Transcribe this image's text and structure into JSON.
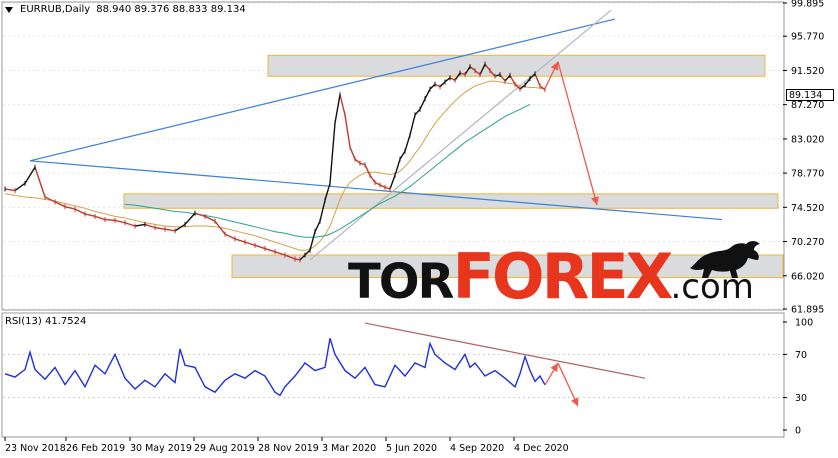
{
  "header": {
    "symbol": "EURRUB,Daily",
    "ohlc": "88.940 89.376 88.833 89.134",
    "arrow_icon": "triangle-down-icon"
  },
  "logo": {
    "part1": "TOR",
    "part2": "FOREX",
    "part3": ".com",
    "colors": {
      "tor": "#111111",
      "forex": "#e8351e",
      "com": "#111111"
    },
    "mascot": "bull-icon"
  },
  "colors": {
    "price_up": "#111111",
    "price_down": "#c0392b",
    "ma_fast": "#d4a04a",
    "ma_slow": "#2aa38a",
    "trend_line": "#3a7fd9",
    "channel_line": "#b0b6c0",
    "zone_fill": "#d9dadc",
    "zone_border": "#f2b233",
    "arrow": "#ee5a4a",
    "rsi_line": "#1f2fe0",
    "rsi_trend": "#b06060",
    "last_price_bg": "#ffffff"
  },
  "chart_data": [
    {
      "type": "line",
      "name": "price",
      "ylim": [
        61.895,
        99.895
      ],
      "y_ticks": [
        "99.895",
        "95.770",
        "91.520",
        "87.270",
        "83.020",
        "78.770",
        "74.520",
        "70.270",
        "66.020",
        "61.895"
      ],
      "last_price": "89.134",
      "x_ticks": [
        "23 Nov 2018",
        "26 Feb 2019",
        "30 May 2019",
        "29 Aug 2019",
        "28 Nov 2019",
        "3 Mar 2020",
        "5 Jun 2020",
        "4 Sep 2020",
        "4 Dec 2020"
      ],
      "x": [
        0,
        10,
        20,
        30,
        40,
        50,
        60,
        70,
        80,
        90,
        100,
        110,
        120,
        130,
        140,
        150,
        160,
        170,
        180,
        190,
        200,
        210,
        220,
        230,
        240,
        250,
        260,
        270,
        280,
        290,
        295,
        300,
        305,
        310,
        315,
        320,
        325,
        330,
        335,
        340,
        345,
        350,
        355,
        360,
        365,
        370,
        375,
        380,
        385,
        390,
        395,
        400,
        405,
        410,
        415,
        420,
        425,
        430,
        435,
        440,
        445,
        450,
        455,
        460,
        465,
        470,
        475,
        480,
        485,
        490,
        495,
        500,
        505,
        510,
        515,
        520,
        525,
        530,
        535,
        540
      ],
      "close": [
        76.8,
        76.6,
        77.5,
        79.5,
        75.8,
        75.2,
        74.6,
        74.3,
        73.7,
        73.4,
        73.0,
        72.9,
        72.6,
        72.2,
        72.4,
        72.0,
        71.8,
        71.6,
        72.4,
        73.8,
        73.4,
        72.8,
        71.2,
        70.6,
        70.2,
        69.8,
        69.4,
        69.0,
        68.6,
        68.1,
        68.0,
        68.6,
        69.2,
        71.5,
        72.8,
        75.4,
        77.5,
        85.0,
        88.5,
        86.0,
        82.0,
        80.5,
        80.0,
        79.8,
        78.5,
        77.6,
        77.3,
        77.0,
        76.8,
        78.5,
        80.5,
        81.5,
        83.5,
        86.0,
        86.7,
        88.0,
        89.2,
        89.8,
        89.5,
        90.1,
        90.6,
        90.3,
        91.2,
        91.0,
        92.0,
        91.5,
        91.0,
        92.3,
        91.5,
        90.8,
        91.0,
        90.2,
        90.9,
        89.8,
        89.2,
        89.7,
        90.5,
        91.1,
        89.6,
        89.134
      ],
      "ma_fast": [
        76.2,
        76.0,
        75.8,
        75.7,
        75.5,
        75.3,
        75.0,
        74.7,
        74.4,
        74.0,
        73.7,
        73.4,
        73.2,
        72.9,
        72.6,
        72.4,
        72.2,
        72.1,
        72.1,
        72.2,
        72.2,
        72.1,
        71.9,
        71.6,
        71.3,
        71.0,
        70.6,
        70.2,
        69.8,
        69.4,
        69.2,
        69.2,
        69.3,
        69.7,
        70.3,
        71.1,
        72.2,
        73.8,
        75.5,
        76.8,
        77.6,
        78.1,
        78.5,
        78.8,
        78.9,
        78.9,
        78.8,
        78.7,
        78.6,
        78.7,
        79.0,
        79.6,
        80.3,
        81.2,
        82.0,
        83.0,
        84.0,
        84.9,
        85.7,
        86.4,
        87.1,
        87.7,
        88.3,
        88.8,
        89.2,
        89.6,
        89.8,
        90.0,
        90.2,
        90.2,
        90.1,
        90.0,
        89.9,
        89.8,
        89.6,
        89.5,
        89.4,
        89.4,
        89.3,
        89.2
      ],
      "ma_slow": [
        null,
        null,
        null,
        null,
        null,
        null,
        null,
        null,
        null,
        null,
        null,
        null,
        74.9,
        74.8,
        74.6,
        74.4,
        74.2,
        74.0,
        73.9,
        73.7,
        73.5,
        73.3,
        73.0,
        72.7,
        72.4,
        72.1,
        71.8,
        71.5,
        71.3,
        71.0,
        70.9,
        70.8,
        70.8,
        70.8,
        70.9,
        71.0,
        71.2,
        71.5,
        71.8,
        72.2,
        72.6,
        73.0,
        73.4,
        73.8,
        74.2,
        74.6,
        75.0,
        75.3,
        75.6,
        75.9,
        76.3,
        76.7,
        77.1,
        77.6,
        78.1,
        78.6,
        79.1,
        79.6,
        80.1,
        80.6,
        81.1,
        81.6,
        82.1,
        82.6,
        83.0,
        83.4,
        83.8,
        84.2,
        84.6,
        85.0,
        85.4,
        85.8,
        86.1,
        86.4,
        86.7,
        87.0,
        87.3,
        null,
        null,
        null
      ],
      "zones": [
        {
          "y0": 90.8,
          "y1": 93.4,
          "x0": 268,
          "x1": 765
        },
        {
          "y0": 74.4,
          "y1": 76.2,
          "x0": 124,
          "x1": 778
        },
        {
          "y0": 65.8,
          "y1": 68.6,
          "x0": 232,
          "x1": 783
        }
      ]
    },
    {
      "type": "line",
      "name": "RSI(13)",
      "label": "RSI(13) 41.7524",
      "ylim": [
        0,
        100
      ],
      "y_ticks": [
        "100",
        "70",
        "30",
        "0"
      ],
      "x": [
        0,
        10,
        20,
        25,
        30,
        40,
        50,
        60,
        70,
        80,
        90,
        100,
        110,
        120,
        130,
        140,
        150,
        160,
        170,
        175,
        180,
        190,
        200,
        210,
        220,
        230,
        240,
        250,
        260,
        270,
        275,
        280,
        290,
        300,
        310,
        320,
        325,
        330,
        340,
        350,
        360,
        370,
        380,
        390,
        400,
        410,
        420,
        425,
        430,
        440,
        450,
        460,
        465,
        470,
        480,
        490,
        500,
        510,
        515,
        520,
        525,
        530,
        535,
        540
      ],
      "values": [
        52,
        49,
        56,
        72,
        56,
        47,
        58,
        42,
        55,
        40,
        60,
        52,
        70,
        48,
        38,
        46,
        40,
        52,
        44,
        75,
        60,
        58,
        40,
        35,
        46,
        52,
        48,
        55,
        50,
        35,
        32,
        40,
        50,
        62,
        55,
        58,
        85,
        70,
        55,
        48,
        58,
        42,
        40,
        60,
        50,
        62,
        58,
        80,
        70,
        62,
        56,
        70,
        58,
        62,
        50,
        55,
        48,
        40,
        52,
        68,
        55,
        45,
        50,
        41.75
      ]
    }
  ]
}
